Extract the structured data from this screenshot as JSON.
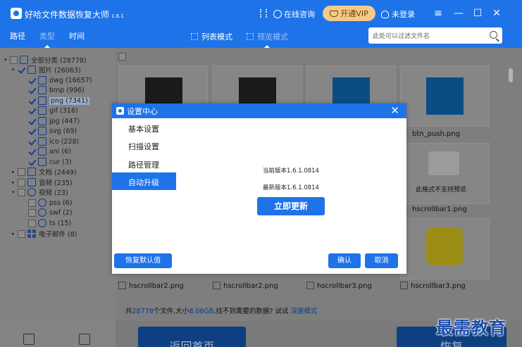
{
  "app": {
    "name": "好哈文件数据恢复大师",
    "version": "1.6.1",
    "online_consult": "在线咨询",
    "vip_label": "开通VIP",
    "login_label": "未登录"
  },
  "toolbar": {
    "tabs": [
      "路径",
      "类型",
      "时间"
    ],
    "active_tab": "类型",
    "list_mode": "列表模式",
    "preview_mode": "预览模式",
    "search_placeholder": "此处可以过滤文件名"
  },
  "tree": {
    "root": "全部分类 (28778)",
    "images": "图片 (26063)",
    "image_types": [
      "dwg (16657)",
      "bmp (996)",
      "png (7341)",
      "gif (316)",
      "jpg (447)",
      "svg (69)",
      "ico (228)",
      "ani (6)",
      "cur (3)"
    ],
    "documents": "文档 (2449)",
    "audio": "音频 (235)",
    "video": "视频 (23)",
    "video_types": [
      "pss (6)",
      "swf (2)",
      "ts (15)"
    ],
    "email": "电子邮件 (8)"
  },
  "grid": {
    "labels": {
      "btn_push": "btn_push.png",
      "unsupported": "此格式不支持预览",
      "hscrollbar1": "hscrollbar1.png",
      "row3": [
        "hscrollbar2.png",
        "hscrollbar2.png",
        "hscrollbar3.png",
        "hscrollbar3.png"
      ]
    }
  },
  "status": {
    "prefix": "共",
    "count": "28778",
    "mid": "个文件,大小",
    "size": "8.06GB",
    "suffix": ",找不到需要的数据? 试试",
    "deep_mode": "深度模式"
  },
  "bottom_buttons": {
    "back_home": "返回首页",
    "recover": "恢复"
  },
  "dialog": {
    "title": "设置中心",
    "menu": [
      "基本设置",
      "扫描设置",
      "路径管理",
      "自动升级"
    ],
    "active_menu": "自动升级",
    "current_version": "当前版本1.6.1.0814",
    "latest_version": "最新版本1.6.1.0814",
    "update_now": "立即更新",
    "restore_default": "恢复默认值",
    "confirm": "确认",
    "cancel": "取消"
  },
  "watermark": "最需教育",
  "colors": {
    "brand_blue": "#1e73e8",
    "vip_gold": "#f5c98a"
  }
}
